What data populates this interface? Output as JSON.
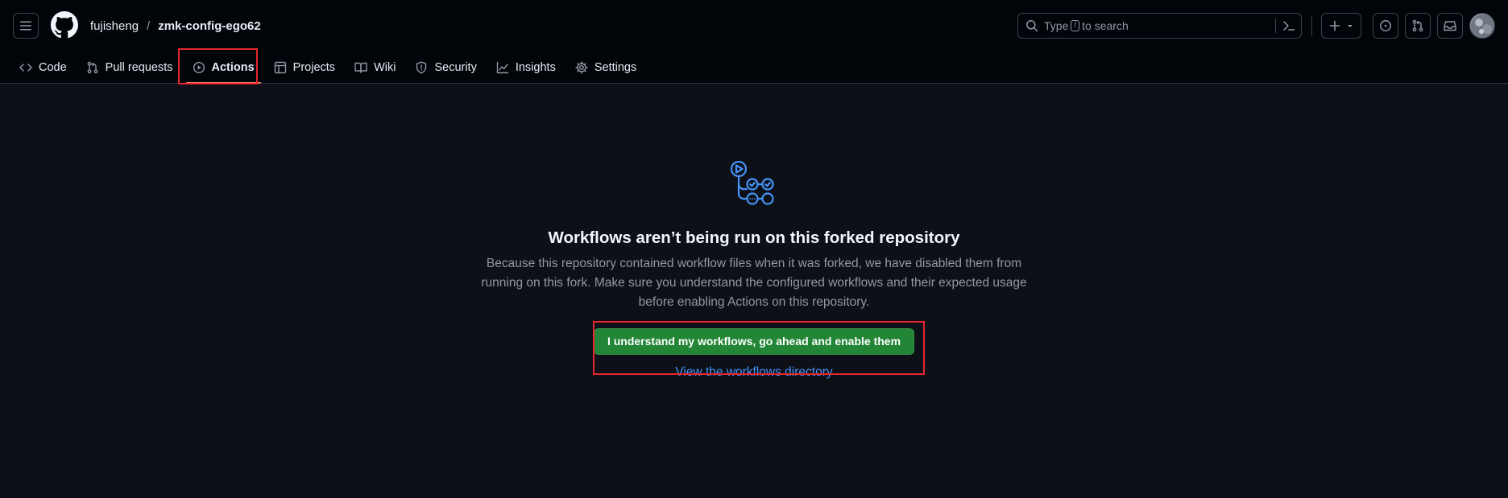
{
  "header": {
    "owner": "fujisheng",
    "separator": "/",
    "repo": "zmk-config-ego62",
    "search": {
      "prefix": "Type",
      "key": "/",
      "suffix": "to search"
    }
  },
  "repo_nav": {
    "items": [
      {
        "label": "Code",
        "icon": "code-icon",
        "selected": false
      },
      {
        "label": "Pull requests",
        "icon": "pull-request-icon",
        "selected": false
      },
      {
        "label": "Actions",
        "icon": "play-icon",
        "selected": true
      },
      {
        "label": "Projects",
        "icon": "table-icon",
        "selected": false
      },
      {
        "label": "Wiki",
        "icon": "book-icon",
        "selected": false
      },
      {
        "label": "Security",
        "icon": "shield-icon",
        "selected": false
      },
      {
        "label": "Insights",
        "icon": "graph-icon",
        "selected": false
      },
      {
        "label": "Settings",
        "icon": "gear-icon",
        "selected": false
      }
    ]
  },
  "main": {
    "icon": "workflow-icon",
    "title": "Workflows aren’t being run on this forked repository",
    "description": "Because this repository contained workflow files when it was forked, we have disabled them from running on this fork. Make sure you understand the configured workflows and their expected usage before enabling Actions on this repository.",
    "enable_button": "I understand my workflows, go ahead and enable them",
    "workflows_link": "View the workflows directory"
  },
  "colors": {
    "background": "#0d1117",
    "header_bg": "#010409",
    "primary_button": "#238636",
    "link": "#4493f8",
    "selected_underline": "#f78166",
    "annotation_box": "#e5262e"
  }
}
